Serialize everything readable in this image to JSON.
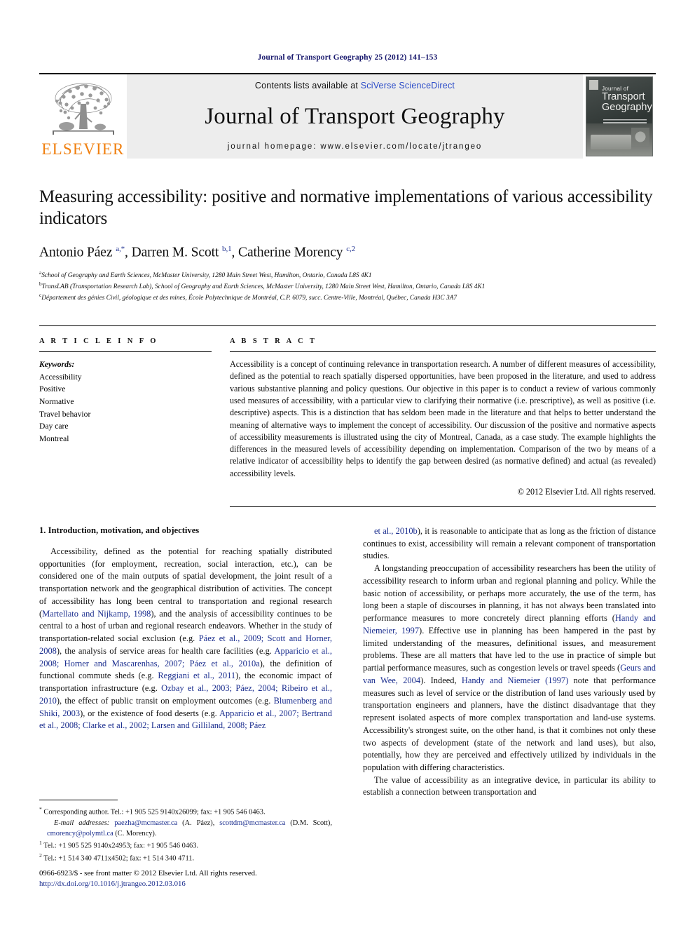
{
  "running_head": "Journal of Transport Geography 25 (2012) 141–153",
  "masthead": {
    "contents_prefix": "Contents lists available at ",
    "contents_link": "SciVerse ScienceDirect",
    "journal_title": "Journal of Transport Geography",
    "homepage": "journal homepage: www.elsevier.com/locate/jtrangeo",
    "publisher_wordmark": "ELSEVIER",
    "cover_line1": "Journal of",
    "cover_line2": "Transport",
    "cover_line3": "Geography",
    "accent_orange": "#F08010",
    "link_blue": "#2a4bc8"
  },
  "article": {
    "title": "Measuring accessibility: positive and normative implementations of various accessibility indicators",
    "authors_html": "Antonio Páez <sup>a,*</sup>, Darren M. Scott <sup>b,1</sup>, Catherine Morency <sup>c,2</sup>",
    "affiliations": [
      {
        "marker": "a",
        "text": "School of Geography and Earth Sciences, McMaster University, 1280 Main Street West, Hamilton, Ontario, Canada L8S 4K1"
      },
      {
        "marker": "b",
        "text": "TransLAB (Transportation Research Lab), School of Geography and Earth Sciences, McMaster University, 1280 Main Street West, Hamilton, Ontario, Canada L8S 4K1"
      },
      {
        "marker": "c",
        "text": "Département des génies Civil, géologique et des mines, École Polytechnique de Montréal, C.P. 6079, succ. Centre-Ville, Montréal, Québec, Canada H3C 3A7"
      }
    ]
  },
  "article_info": {
    "heading": "A R T I C L E   I N F O",
    "keywords_label": "Keywords:",
    "keywords": [
      "Accessibility",
      "Positive",
      "Normative",
      "Travel behavior",
      "Day care",
      "Montreal"
    ]
  },
  "abstract": {
    "heading": "A B S T R A C T",
    "text": "Accessibility is a concept of continuing relevance in transportation research. A number of different measures of accessibility, defined as the potential to reach spatially dispersed opportunities, have been proposed in the literature, and used to address various substantive planning and policy questions. Our objective in this paper is to conduct a review of various commonly used measures of accessibility, with a particular view to clarifying their normative (i.e. prescriptive), as well as positive (i.e. descriptive) aspects. This is a distinction that has seldom been made in the literature and that helps to better understand the meaning of alternative ways to implement the concept of accessibility. Our discussion of the positive and normative aspects of accessibility measurements is illustrated using the city of Montreal, Canada, as a case study. The example highlights the differences in the measured levels of accessibility depending on implementation. Comparison of the two by means of a relative indicator of accessibility helps to identify the gap between desired (as normative defined) and actual (as revealed) accessibility levels.",
    "copyright": "© 2012 Elsevier Ltd. All rights reserved."
  },
  "body": {
    "section_heading": "1. Introduction, motivation, and objectives",
    "left_paragraph_1_parts": [
      {
        "t": "Accessibility, defined as the potential for reaching spatially distributed opportunities (for employment, recreation, social interaction, etc.), can be considered one of the main outputs of spatial development, the joint result of a transportation network and the geographical distribution of activities. The concept of accessibility has long been central to transportation and regional research (",
        "cite": false
      },
      {
        "t": "Martellato and Nijkamp, 1998",
        "cite": true
      },
      {
        "t": "), and the analysis of accessibility continues to be central to a host of urban and regional research endeavors. Whether in the study of transportation-related social exclusion (e.g. ",
        "cite": false
      },
      {
        "t": "Páez et al., 2009; Scott and Horner, 2008",
        "cite": true
      },
      {
        "t": "), the analysis of service areas for health care facilities (e.g. ",
        "cite": false
      },
      {
        "t": "Apparicio et al., 2008; Horner and Mascarenhas, 2007; Páez et al., 2010a",
        "cite": true
      },
      {
        "t": "), the definition of functional commute sheds (e.g. ",
        "cite": false
      },
      {
        "t": "Reggiani et al., 2011",
        "cite": true
      },
      {
        "t": "), the economic impact of transportation infrastructure (e.g. ",
        "cite": false
      },
      {
        "t": "Ozbay et al., 2003; Páez, 2004; Ribeiro et al., 2010",
        "cite": true
      },
      {
        "t": "), the effect of public transit on employment outcomes (e.g. ",
        "cite": false
      },
      {
        "t": "Blumenberg and Shiki, 2003",
        "cite": true
      },
      {
        "t": "), or the existence of food deserts (e.g. ",
        "cite": false
      },
      {
        "t": "Apparicio et al., 2007; Bertrand et al., 2008; Clarke et al., 2002; Larsen and Gilliland, 2008; Páez",
        "cite": true
      }
    ],
    "right_paragraph_1_parts": [
      {
        "t": "et al., 2010b",
        "cite": true
      },
      {
        "t": "), it is reasonable to anticipate that as long as the friction of distance continues to exist, accessibility will remain a relevant component of transportation studies.",
        "cite": false
      }
    ],
    "right_paragraph_2_parts": [
      {
        "t": "A longstanding preoccupation of accessibility researchers has been the utility of accessibility research to inform urban and regional planning and policy. While the basic notion of accessibility, or perhaps more accurately, the use of the term, has long been a staple of discourses in planning, it has not always been translated into performance measures to more concretely direct planning efforts (",
        "cite": false
      },
      {
        "t": "Handy and Niemeier, 1997",
        "cite": true
      },
      {
        "t": "). Effective use in planning has been hampered in the past by limited understanding of the measures, definitional issues, and measurement problems. These are all matters that have led to the use in practice of simple but partial performance measures, such as congestion levels or travel speeds (",
        "cite": false
      },
      {
        "t": "Geurs and van Wee, 2004",
        "cite": true
      },
      {
        "t": "). Indeed, ",
        "cite": false
      },
      {
        "t": "Handy and Niemeier (1997)",
        "cite": true
      },
      {
        "t": " note that performance measures such as level of service or the distribution of land uses variously used by transportation engineers and planners, have the distinct disadvantage that they represent isolated aspects of more complex transportation and land-use systems. Accessibility's strongest suite, on the other hand, is that it combines not only these two aspects of development (state of the network and land uses), but also, potentially, how they are perceived and effectively utilized by individuals in the population with differing characteristics.",
        "cite": false
      }
    ],
    "right_paragraph_3_parts": [
      {
        "t": "The value of accessibility as an integrative device, in particular its ability to establish a connection between transportation and",
        "cite": false
      }
    ]
  },
  "footnotes": {
    "corresponding_marker": "*",
    "corresponding": "Corresponding author. Tel.: +1 905 525 9140x26099; fax: +1 905 546 0463.",
    "email_label": "E-mail addresses:",
    "email_1": "paezha@mcmaster.ca",
    "email_1_owner": "(A. Páez),",
    "email_2": "scottdm@mcmaster.ca",
    "email_2_owner": "(D.M. Scott),",
    "email_3": "cmorency@polymtl.ca",
    "email_3_owner": "(C. Morency).",
    "note_1_marker": "1",
    "note_1": "Tel.: +1 905 525 9140x24953; fax: +1 905 546 0463.",
    "note_2_marker": "2",
    "note_2": "Tel.: +1 514 340 4711x4502; fax: +1 514 340 4711."
  },
  "imprint": {
    "line1": "0966-6923/$ - see front matter © 2012 Elsevier Ltd. All rights reserved.",
    "doi": "http://dx.doi.org/10.1016/j.jtrangeo.2012.03.016"
  }
}
